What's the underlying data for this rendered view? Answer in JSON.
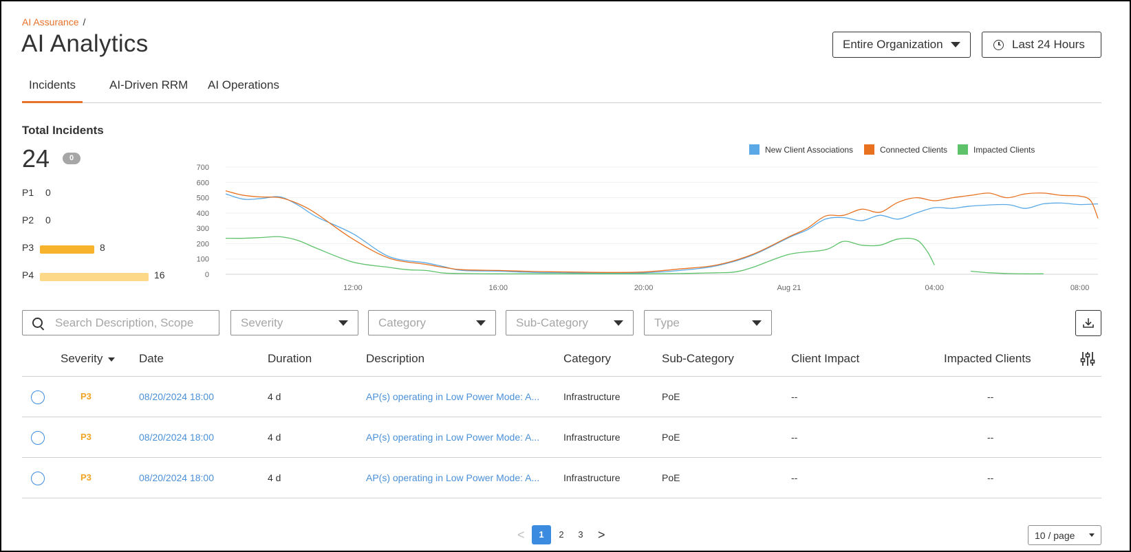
{
  "header": {
    "breadcrumb_link": "AI Assurance",
    "breadcrumb_sep": "/",
    "title": "AI Analytics",
    "org_selector": "Entire Organization",
    "time_selector": "Last 24 Hours"
  },
  "tabs": [
    {
      "label": "Incidents",
      "active": true
    },
    {
      "label": "AI-Driven RRM",
      "active": false
    },
    {
      "label": "AI Operations",
      "active": false
    }
  ],
  "summary": {
    "label": "Total Incidents",
    "total": "24",
    "badge": "0",
    "priorities": [
      {
        "label": "P1",
        "count": "0",
        "value": 0,
        "color": "#f5b32a"
      },
      {
        "label": "P2",
        "count": "0",
        "value": 0,
        "color": "#f5b32a"
      },
      {
        "label": "P3",
        "count": "8",
        "value": 8,
        "color": "#f7b32b"
      },
      {
        "label": "P4",
        "count": "16",
        "value": 16,
        "color": "#fdd889"
      }
    ]
  },
  "chart_data": {
    "type": "line",
    "x_domain_hours": [
      8.5,
      32.5
    ],
    "x_ticks": [
      {
        "label": "12:00",
        "hour": 12
      },
      {
        "label": "16:00",
        "hour": 16
      },
      {
        "label": "20:00",
        "hour": 20
      },
      {
        "label": "Aug 21",
        "hour": 24
      },
      {
        "label": "04:00",
        "hour": 28
      },
      {
        "label": "08:00",
        "hour": 32
      }
    ],
    "y_ticks": [
      0,
      100,
      200,
      300,
      400,
      500,
      600,
      700
    ],
    "ylim": [
      0,
      700
    ],
    "grid": true,
    "legend_position": "top-right",
    "series": [
      {
        "name": "New Client Associations",
        "color": "#5aa9e6",
        "points": [
          [
            8.5,
            525
          ],
          [
            9,
            490
          ],
          [
            9.5,
            495
          ],
          [
            10,
            505
          ],
          [
            10.5,
            450
          ],
          [
            11,
            375
          ],
          [
            12,
            265
          ],
          [
            13,
            115
          ],
          [
            14,
            75
          ],
          [
            14.5,
            50
          ],
          [
            15,
            25
          ],
          [
            16,
            20
          ],
          [
            17,
            12
          ],
          [
            18,
            10
          ],
          [
            19,
            8
          ],
          [
            20,
            10
          ],
          [
            21,
            25
          ],
          [
            22,
            55
          ],
          [
            23,
            125
          ],
          [
            24,
            240
          ],
          [
            24.5,
            290
          ],
          [
            25,
            360
          ],
          [
            25.5,
            370
          ],
          [
            26,
            350
          ],
          [
            26.5,
            385
          ],
          [
            27,
            360
          ],
          [
            27.5,
            400
          ],
          [
            28,
            435
          ],
          [
            28.5,
            430
          ],
          [
            29,
            445
          ],
          [
            30,
            455
          ],
          [
            30.5,
            430
          ],
          [
            31,
            460
          ],
          [
            31.5,
            465
          ],
          [
            32,
            455
          ],
          [
            32.5,
            460
          ]
        ]
      },
      {
        "name": "Connected Clients",
        "color": "#e8711f",
        "points": [
          [
            8.5,
            545
          ],
          [
            9,
            515
          ],
          [
            9.5,
            505
          ],
          [
            10,
            500
          ],
          [
            10.5,
            460
          ],
          [
            11,
            395
          ],
          [
            12,
            230
          ],
          [
            13,
            105
          ],
          [
            14,
            65
          ],
          [
            14.5,
            45
          ],
          [
            15,
            30
          ],
          [
            16,
            25
          ],
          [
            17,
            18
          ],
          [
            18,
            15
          ],
          [
            19,
            12
          ],
          [
            20,
            15
          ],
          [
            21,
            35
          ],
          [
            22,
            60
          ],
          [
            23,
            130
          ],
          [
            24,
            245
          ],
          [
            24.5,
            300
          ],
          [
            25,
            380
          ],
          [
            25.5,
            385
          ],
          [
            26,
            425
          ],
          [
            26.5,
            405
          ],
          [
            27,
            470
          ],
          [
            27.5,
            500
          ],
          [
            28,
            480
          ],
          [
            28.5,
            500
          ],
          [
            29,
            515
          ],
          [
            29.5,
            530
          ],
          [
            30,
            500
          ],
          [
            30.5,
            525
          ],
          [
            31,
            530
          ],
          [
            31.5,
            515
          ],
          [
            32,
            510
          ],
          [
            32.3,
            480
          ],
          [
            32.5,
            365
          ]
        ]
      },
      {
        "name": "Impacted Clients",
        "color": "#5dc26a",
        "points": [
          [
            8.5,
            235
          ],
          [
            9,
            235
          ],
          [
            9.5,
            240
          ],
          [
            10,
            245
          ],
          [
            10.5,
            220
          ],
          [
            11,
            170
          ],
          [
            12,
            80
          ],
          [
            13,
            45
          ],
          [
            13.5,
            30
          ],
          [
            14,
            25
          ],
          [
            14.5,
            8
          ],
          [
            15,
            5
          ],
          [
            16,
            3
          ],
          [
            17,
            3
          ],
          [
            18,
            3
          ],
          [
            19,
            3
          ],
          [
            20,
            3
          ],
          [
            21,
            5
          ],
          [
            22,
            10
          ],
          [
            22.5,
            15
          ],
          [
            23,
            45
          ],
          [
            24,
            130
          ],
          [
            25,
            160
          ],
          [
            25.5,
            215
          ],
          [
            26,
            190
          ],
          [
            26.5,
            190
          ],
          [
            27,
            230
          ],
          [
            27.5,
            225
          ],
          [
            27.8,
            150
          ],
          [
            28,
            60
          ]
        ],
        "points2": [
          [
            29,
            20
          ],
          [
            29.5,
            10
          ],
          [
            30,
            5
          ],
          [
            30.5,
            3
          ],
          [
            31,
            3
          ]
        ]
      }
    ]
  },
  "filters": {
    "search_placeholder": "Search Description, Scope",
    "severity": "Severity",
    "category": "Category",
    "sub_category": "Sub-Category",
    "type": "Type"
  },
  "table": {
    "columns": [
      "Severity",
      "Date",
      "Duration",
      "Description",
      "Category",
      "Sub-Category",
      "Client Impact",
      "Impacted Clients"
    ],
    "rows": [
      {
        "severity": "P3",
        "date": "08/20/2024 18:00",
        "duration": "4 d",
        "description": "AP(s) operating in Low Power Mode: A...",
        "category": "Infrastructure",
        "sub_category": "PoE",
        "client_impact": "--",
        "impacted_clients": "--"
      },
      {
        "severity": "P3",
        "date": "08/20/2024 18:00",
        "duration": "4 d",
        "description": "AP(s) operating in Low Power Mode: A...",
        "category": "Infrastructure",
        "sub_category": "PoE",
        "client_impact": "--",
        "impacted_clients": "--"
      },
      {
        "severity": "P3",
        "date": "08/20/2024 18:00",
        "duration": "4 d",
        "description": "AP(s) operating in Low Power Mode: A...",
        "category": "Infrastructure",
        "sub_category": "PoE",
        "client_impact": "--",
        "impacted_clients": "--"
      }
    ]
  },
  "pagination": {
    "prev": "<",
    "next": ">",
    "pages": [
      "1",
      "2",
      "3"
    ],
    "current": "1",
    "page_size": "10 / page"
  }
}
